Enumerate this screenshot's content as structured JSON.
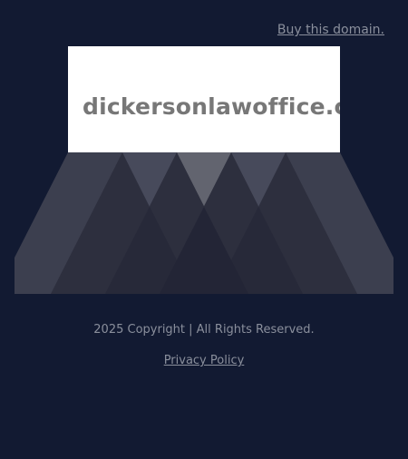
{
  "header": {
    "buy_link": "Buy this domain."
  },
  "domain": {
    "name": "dickersonlawoffice.com"
  },
  "footer": {
    "copyright": "2025 Copyright | All Rights Reserved.",
    "privacy": "Privacy Policy "
  },
  "colors": {
    "background": "#121a32",
    "box": "#ffffff",
    "domain_text": "#777777",
    "link_text": "#8a8f9c"
  }
}
